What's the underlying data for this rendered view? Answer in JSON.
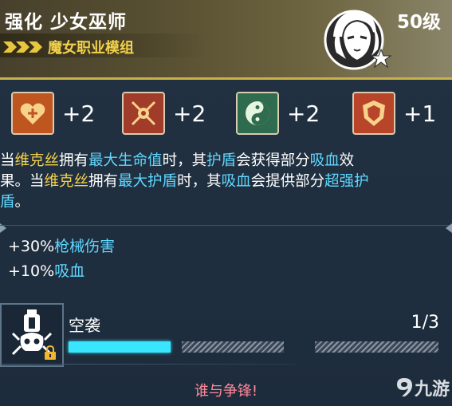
{
  "header": {
    "title": "强化 少女巫师",
    "subtitle": "魔女职业模组",
    "level": "50级",
    "portrait_icon": "girl-portrait-icon",
    "accent_color": "#f2d24c"
  },
  "attributes": [
    {
      "icon": "heart-arrow-icon",
      "value": "+2",
      "icon_bg": "#c0561f"
    },
    {
      "icon": "crossed-blades-icon",
      "value": "+2",
      "icon_bg": "#a13b2a"
    },
    {
      "icon": "yin-yang-icon",
      "value": "+2",
      "icon_bg": "#2f6b4e"
    },
    {
      "icon": "shield-crest-icon",
      "value": "+1",
      "icon_bg": "#b8442a"
    }
  ],
  "description": {
    "l1_a": "当",
    "l1_b": "维克丝",
    "l1_c": "拥有",
    "l1_d": "最大生命值",
    "l1_e": "时，其",
    "l1_f": "护盾",
    "l1_g": "会获得部分",
    "l1_h": "吸血",
    "l1_i": "效",
    "l2_a": "果。当",
    "l2_b": "维克丝",
    "l2_c": "拥有",
    "l2_d": "最大护盾",
    "l2_e": "时，其",
    "l2_f": "吸血",
    "l2_g": "会提供部分",
    "l2_h": "超强护",
    "l3_a": "盾",
    "l3_b": "。"
  },
  "stats": [
    {
      "value": "+30%",
      "label": "枪械伤害"
    },
    {
      "value": "+10%",
      "label": "吸血"
    }
  ],
  "skill": {
    "icon": "skull-turret-icon",
    "lock_icon": "lock-icon",
    "name": "空袭",
    "count": "1/3",
    "progress_segments_filled": 1,
    "progress_segments_total": 3,
    "flavor": "谁与争锋!"
  },
  "watermark": {
    "icon": "nine-game-logo-icon",
    "text": "九游"
  }
}
